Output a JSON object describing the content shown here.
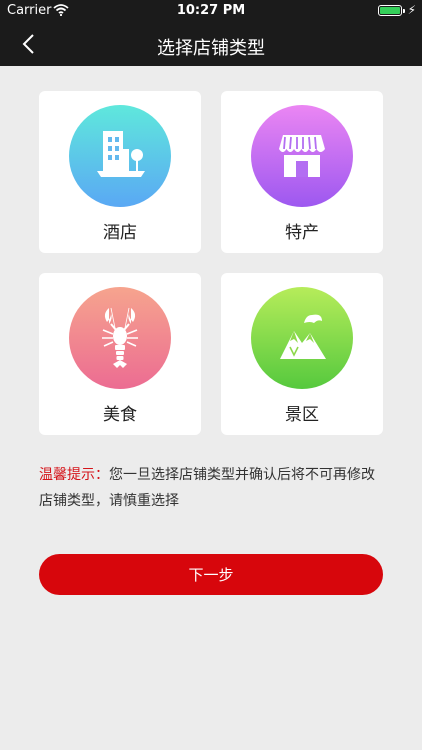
{
  "status_bar": {
    "carrier": "Carrier",
    "time": "10:27 PM",
    "battery_level": 1.0,
    "battery_color": "#35d05a"
  },
  "nav": {
    "title": "选择店铺类型",
    "back_icon": "chevron-left-icon"
  },
  "store_types": [
    {
      "label": "酒店",
      "icon": "hotel-building-icon",
      "gradient": [
        "#5fe8dc",
        "#5aa8f4"
      ]
    },
    {
      "label": "特产",
      "icon": "storefront-icon",
      "gradient": [
        "#eb86f3",
        "#9d58f0"
      ]
    },
    {
      "label": "美食",
      "icon": "lobster-icon",
      "gradient": [
        "#f6a48e",
        "#ec6c92"
      ]
    },
    {
      "label": "景区",
      "icon": "mountain-landscape-icon",
      "gradient": [
        "#b6ec5a",
        "#56c93e"
      ]
    }
  ],
  "notice": {
    "label": "温馨提示：",
    "text": "您一旦选择店铺类型并确认后将不可再修改店铺类型，请慎重选择"
  },
  "next_button": {
    "label": "下一步"
  },
  "colors": {
    "accent": "#d7060c",
    "header_bg": "#1b1b1b",
    "page_bg": "#ececec",
    "notice_label": "#d5141a"
  }
}
